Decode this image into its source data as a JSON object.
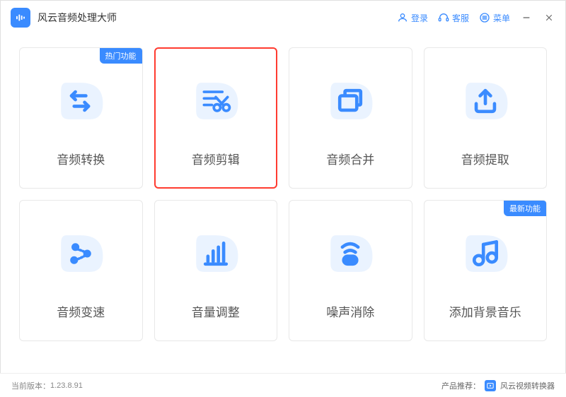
{
  "app": {
    "title": "风云音频处理大师"
  },
  "titlebar": {
    "login": "登录",
    "support": "客服",
    "menu": "菜单"
  },
  "badges": {
    "hot": "热门功能",
    "new": "最新功能"
  },
  "cards": [
    {
      "label": "音频转换",
      "badge": "hot",
      "icon": "convert"
    },
    {
      "label": "音频剪辑",
      "badge": null,
      "icon": "cut",
      "selected": true
    },
    {
      "label": "音频合并",
      "badge": null,
      "icon": "merge"
    },
    {
      "label": "音频提取",
      "badge": null,
      "icon": "extract"
    },
    {
      "label": "音频变速",
      "badge": null,
      "icon": "speed"
    },
    {
      "label": "音量调整",
      "badge": null,
      "icon": "volume"
    },
    {
      "label": "噪声消除",
      "badge": null,
      "icon": "denoise"
    },
    {
      "label": "添加背景音乐",
      "badge": "new",
      "icon": "bgm"
    }
  ],
  "footer": {
    "version_label": "当前版本：",
    "version": "1.23.8.91",
    "rec_label": "产品推荐：",
    "rec_product": "风云视频转换器"
  },
  "colors": {
    "accent": "#3a8bff"
  }
}
